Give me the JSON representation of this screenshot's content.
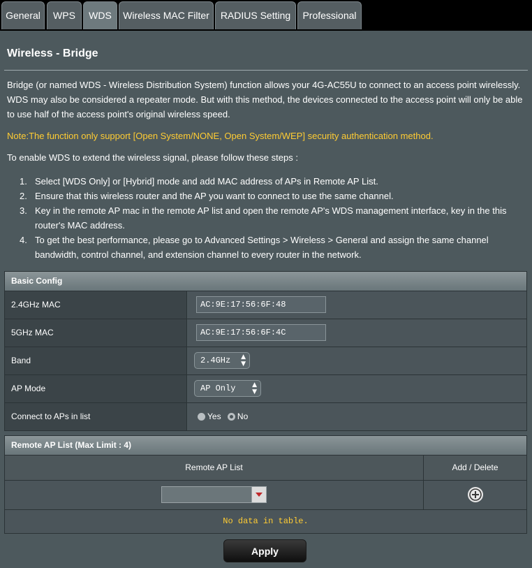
{
  "tabs": [
    {
      "label": "General"
    },
    {
      "label": "WPS"
    },
    {
      "label": "WDS"
    },
    {
      "label": "Wireless MAC Filter"
    },
    {
      "label": "RADIUS Setting"
    },
    {
      "label": "Professional"
    }
  ],
  "active_tab": "WDS",
  "page": {
    "title": "Wireless - Bridge",
    "description": "Bridge (or named WDS - Wireless Distribution System) function allows your 4G-AC55U to connect to an access point wirelessly. WDS may also be considered a repeater mode. But with this method, the devices connected to the access point will only be able to use half of the access point's original wireless speed.",
    "note": "Note:The function only support [Open System/NONE, Open System/WEP] security authentication method.",
    "steps_intro": "To enable WDS to extend the wireless signal, please follow these steps :",
    "steps": [
      {
        "num": "1.",
        "text": "Select [WDS Only] or [Hybrid] mode and add MAC address of APs in Remote AP List."
      },
      {
        "num": "2.",
        "text": "Ensure that this wireless router and the AP you want to connect to use the same channel."
      },
      {
        "num": "3.",
        "text": "Key in the remote AP mac in the remote AP list and open the remote AP's WDS management interface, key in the this router's MAC address."
      },
      {
        "num": "4.",
        "text": "To get the best performance, please go to Advanced Settings > Wireless > General and assign the same channel bandwidth, control channel, and extension channel to every router in the network."
      }
    ]
  },
  "basic_config": {
    "header": "Basic Config",
    "mac24_label": "2.4GHz MAC",
    "mac24_value": "AC:9E:17:56:6F:48",
    "mac5_label": "5GHz MAC",
    "mac5_value": "AC:9E:17:56:6F:4C",
    "band_label": "Band",
    "band_value": "2.4GHz",
    "apmode_label": "AP Mode",
    "apmode_value": "AP Only",
    "connect_label": "Connect to APs in list",
    "connect_yes": "Yes",
    "connect_no": "No",
    "connect_selected": "No",
    "arrow_glyph": "▴▾"
  },
  "remote_ap": {
    "header": "Remote AP List (Max Limit : 4)",
    "col_list": "Remote AP List",
    "col_action": "Add / Delete",
    "add_icon": "add-circle-icon",
    "empty_text": "No data in table."
  },
  "apply_label": "Apply"
}
